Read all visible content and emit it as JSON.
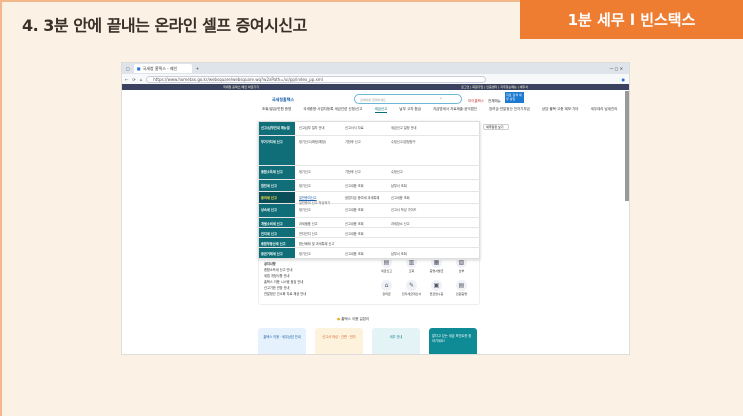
{
  "slide": {
    "title": "4. 3분 안에 끝내는 온라인 셀프 증여시신고",
    "badge": "1분 세무 l 빈스택스",
    "accent": "#ee7d31"
  },
  "browser": {
    "tab_title": "국세청 홈택스 - 메인",
    "url": "https://www.hometax.go.kr/websquare/websquare.wq?w2xPath=/ui/pp/index_pp.xml",
    "strip_text": "국세청 홈택스 메인 바로가기",
    "top_links": "로그인 | 회원가입 | 인증센터 | 자주찾는메뉴 | 세무서"
  },
  "site": {
    "logo": "국세청홈택스",
    "search_placeholder": "검색어를 입력하세요",
    "header_buttons": [
      "마이홈택스",
      "전체메뉴"
    ],
    "quick_button": "자료 검색 세무 상담",
    "nav": [
      "조회/발급/민원 증명",
      "국세증명·사업자등록 세금관련 신청/신고",
      "세금신고",
      "납부 고지·환급",
      "지급명세서 자료제출·공익법인",
      "장려금·연말정산 전자기부금",
      "상담·불복·고충 제보·기타",
      "세무대리 납세관리"
    ],
    "schedule_button": "세무일정 보기"
  },
  "menu": {
    "rows": [
      {
        "label": "신고/납부안내 매뉴얼",
        "items": [
          "신고납부 절차 안내",
          "신고서식 자료",
          "세금신고 일정 안내"
        ]
      },
      {
        "label": "부가가치세 신고",
        "items": [
          "정기신고(확정/예정)",
          "기한후 신고",
          "수정신고/경정청구"
        ]
      },
      {
        "label": "종합소득세 신고",
        "items": [
          "정기신고",
          "기한후 신고",
          "수정신고"
        ]
      },
      {
        "label": "원천세 신고",
        "items": [
          "정기신고",
          "신고내용 조회",
          "납부서 조회"
        ]
      },
      {
        "label": "증여세 신고",
        "items": [
          "일반증여신고",
          "창업자금 증여세 과세특례",
          "신고내용 조회"
        ]
      },
      {
        "label": "상속세 신고",
        "items": [
          "정기신고",
          "신고내용 조회",
          "신고서 작성 가이드"
        ]
      },
      {
        "label": "개별소비세 신고",
        "items": [
          "과세물품 신고",
          "신고내용 조회",
          "과세장소 신고"
        ]
      },
      {
        "label": "인지세 신고",
        "items": [
          "전자인지 신고",
          "신고내용 조회"
        ]
      },
      {
        "label": "종합부동산세 신고",
        "items": [
          "합산배제 및 과세특례 신고"
        ]
      },
      {
        "label": "증권거래세 신고",
        "items": [
          "정기신고",
          "신고내용 조회",
          "납부서 조회"
        ]
      }
    ],
    "submenu_hint": "일반증여 신고 작성하기"
  },
  "notices": {
    "title": "공지사항",
    "items": [
      "종합소득세 신고 안내",
      "세법 개정사항 안내",
      "홈택스 이용 시스템 점검 안내",
      "신고기한 연장 안내",
      "연말정산 간소화 자료 제공 안내"
    ]
  },
  "quick_icons": [
    "세금신고",
    "조회",
    "증명서발급",
    "납부",
    "장려금",
    "전자세금계산서",
    "현금영수증",
    "민원증명"
  ],
  "guide": {
    "title": "홈택스 이용 길잡이",
    "cards": [
      "홈택스 이용 · 세무상담 안내",
      "신고서 작성 · 간편 · 전자",
      "세무 안내",
      "알차고 있는 세금 포인트를 찾아가세요!"
    ]
  }
}
